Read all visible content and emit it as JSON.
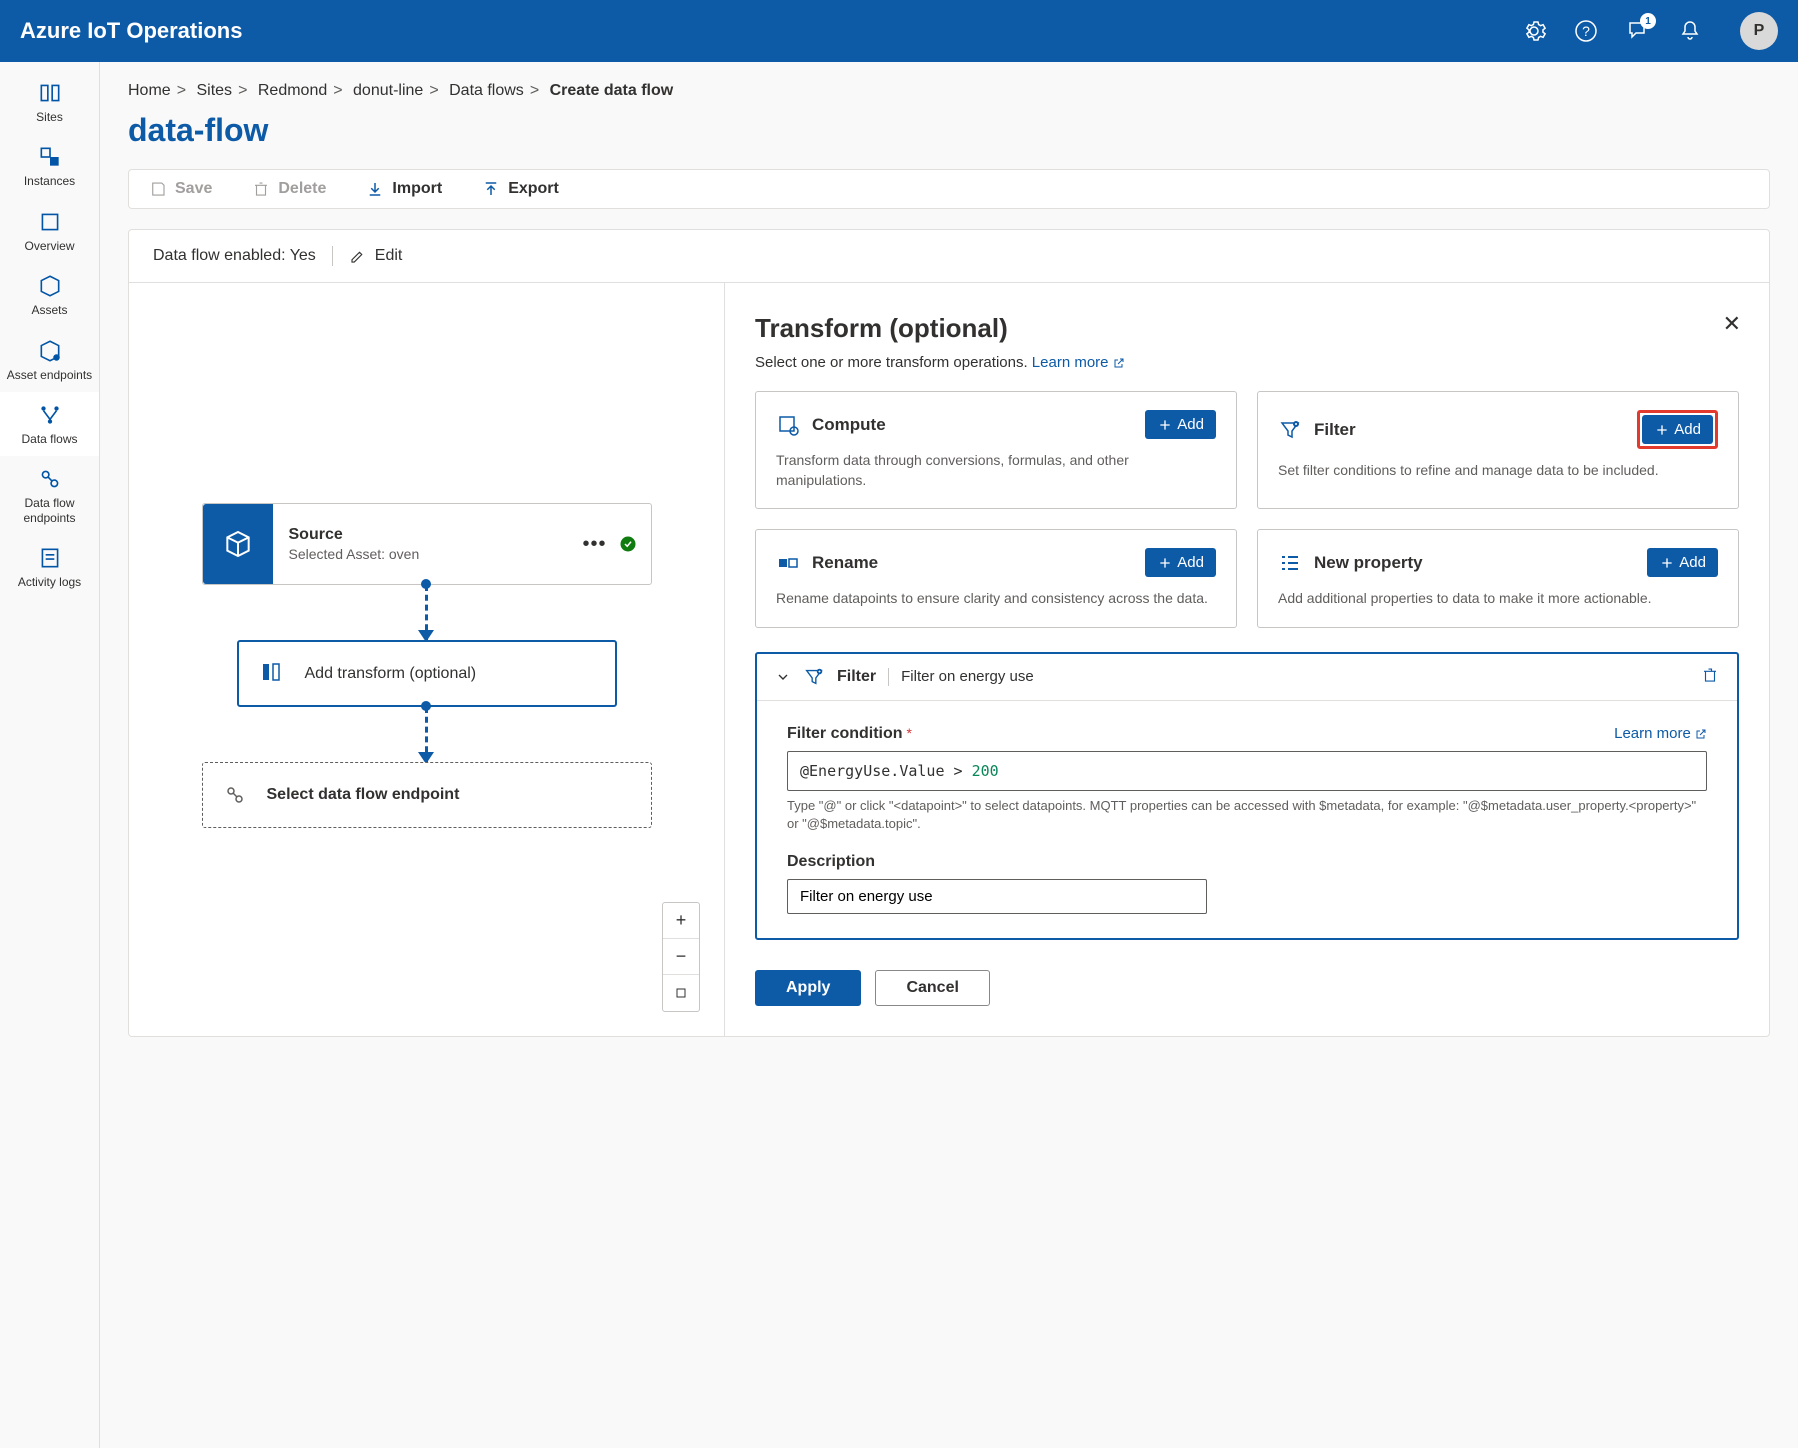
{
  "header": {
    "title": "Azure IoT Operations",
    "notification_count": "1",
    "avatar_initial": "P"
  },
  "sidebar": {
    "items": [
      {
        "label": "Sites"
      },
      {
        "label": "Instances"
      },
      {
        "label": "Overview"
      },
      {
        "label": "Assets"
      },
      {
        "label": "Asset endpoints"
      },
      {
        "label": "Data flows"
      },
      {
        "label": "Data flow endpoints"
      },
      {
        "label": "Activity logs"
      }
    ]
  },
  "breadcrumb": {
    "items": [
      "Home",
      "Sites",
      "Redmond",
      "donut-line",
      "Data flows"
    ],
    "current": "Create data flow"
  },
  "page_title": "data-flow",
  "toolbar": {
    "save": "Save",
    "delete": "Delete",
    "import": "Import",
    "export": "Export"
  },
  "enabled_row": {
    "label": "Data flow enabled: Yes",
    "edit": "Edit"
  },
  "graph": {
    "source": {
      "title": "Source",
      "subtitle": "Selected Asset: oven"
    },
    "transform": {
      "label": "Add transform (optional)"
    },
    "endpoint": {
      "label": "Select data flow endpoint"
    }
  },
  "details": {
    "title": "Transform (optional)",
    "subtitle_text": "Select one or more transform operations. ",
    "learn_more": "Learn more",
    "cards": {
      "compute": {
        "title": "Compute",
        "desc": "Transform data through conversions, formulas, and other manipulations.",
        "add": "Add"
      },
      "filter": {
        "title": "Filter",
        "desc": "Set filter conditions to refine and manage data to be included.",
        "add": "Add"
      },
      "rename": {
        "title": "Rename",
        "desc": "Rename datapoints to ensure clarity and consistency across the data.",
        "add": "Add"
      },
      "newprop": {
        "title": "New property",
        "desc": "Add additional properties to data to make it more actionable.",
        "add": "Add"
      }
    },
    "filter_panel": {
      "head_title": "Filter",
      "head_desc": "Filter on energy use",
      "condition_label": "Filter condition",
      "learn_more": "Learn more",
      "condition_value_prefix": "@EnergyUse.Value > ",
      "condition_value_num": "200",
      "hint": "Type \"@\" or click \"<datapoint>\" to select datapoints. MQTT properties can be accessed with $metadata, for example: \"@$metadata.user_property.<property>\" or \"@$metadata.topic\".",
      "desc_label": "Description",
      "desc_value": "Filter on energy use"
    },
    "apply": "Apply",
    "cancel": "Cancel"
  }
}
